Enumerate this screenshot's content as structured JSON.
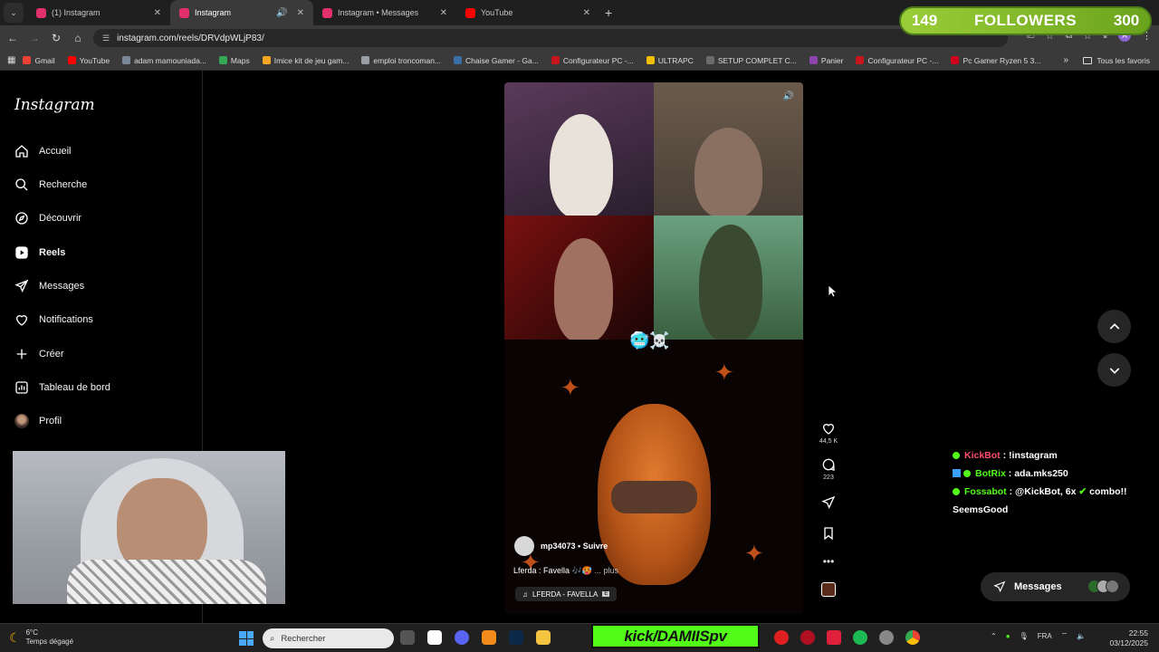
{
  "browser": {
    "tabs": [
      {
        "label": "(1) Instagram",
        "active": false,
        "favicon_color": "#e1306c"
      },
      {
        "label": "Instagram",
        "active": true,
        "favicon_color": "#e1306c"
      },
      {
        "label": "Instagram • Messages",
        "active": false,
        "favicon_color": "#e1306c"
      },
      {
        "label": "YouTube",
        "active": false,
        "favicon_color": "#ff0000"
      }
    ],
    "url": "instagram.com/reels/DRVdpWLjP83/",
    "bookmarks": [
      {
        "label": "Gmail",
        "color": "#ea4335"
      },
      {
        "label": "YouTube",
        "color": "#ff0000"
      },
      {
        "label": "adam mamouniada...",
        "color": "#7a8899"
      },
      {
        "label": "Maps",
        "color": "#34a853"
      },
      {
        "label": "Imice kit de jeu gam...",
        "color": "#f5a623"
      },
      {
        "label": "emploi troncoman...",
        "color": "#9aa0a6"
      },
      {
        "label": "Chaise Gamer - Ga...",
        "color": "#3a6ea5"
      },
      {
        "label": "Configurateur PC -...",
        "color": "#c4161c"
      },
      {
        "label": "ULTRAPC",
        "color": "#f0c000"
      },
      {
        "label": "SETUP COMPLET C...",
        "color": "#6b6b6b"
      },
      {
        "label": "Panier",
        "color": "#8e44ad"
      },
      {
        "label": "Configurateur PC -...",
        "color": "#c4161c"
      },
      {
        "label": "Pc Gamer Ryzen 5 3...",
        "color": "#d0021b"
      }
    ],
    "all_favorites": "Tous les favoris"
  },
  "sidebar": {
    "logo": "Instagram",
    "items": [
      {
        "label": "Accueil",
        "icon": "home-icon"
      },
      {
        "label": "Recherche",
        "icon": "search-icon"
      },
      {
        "label": "Découvrir",
        "icon": "compass-icon"
      },
      {
        "label": "Reels",
        "icon": "reels-icon",
        "active": true
      },
      {
        "label": "Messages",
        "icon": "messenger-icon"
      },
      {
        "label": "Notifications",
        "icon": "heart-icon"
      },
      {
        "label": "Créer",
        "icon": "plus-icon"
      },
      {
        "label": "Tableau de bord",
        "icon": "dashboard-icon"
      },
      {
        "label": "Profil",
        "icon": "avatar"
      }
    ]
  },
  "reel": {
    "username": "mp34073",
    "follow": "Suivre",
    "caption_start": "Lferda : Favella",
    "caption_more": "... plus",
    "audio": "LFERDA - FAVELLA",
    "emoji": "🥶☠️",
    "likes": "44,5 K",
    "comments": "223"
  },
  "overlay": {
    "followers_current": "149",
    "followers_label": "FOLLOWERS",
    "followers_goal": "300",
    "chat": [
      {
        "user": "KickBot",
        "user_color": "#ff4d6d",
        "message": "!instagram"
      },
      {
        "user": "BotRix",
        "user_color": "#53fc18",
        "message": "ada.mks250"
      },
      {
        "user": "Fossabot",
        "user_color": "#53fc18",
        "message": "@KickBot, 6x",
        "tail": "combo!! SeemsGood"
      }
    ],
    "kick_banner": "kick/DAMIISpv"
  },
  "messages_button": "Messages",
  "taskbar": {
    "temperature": "6°C",
    "weather": "Temps dégagé",
    "search_placeholder": "Rechercher",
    "lang": "FRA",
    "time": "22:55",
    "date": "03/12/2025"
  },
  "colors": {
    "kick_green": "#53fc18",
    "followers_green": "#7ab829"
  }
}
